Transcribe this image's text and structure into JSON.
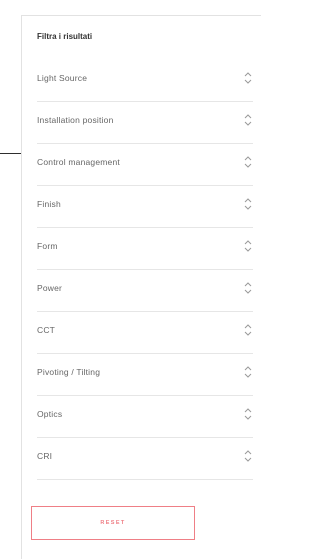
{
  "filters": {
    "title": "Filtra i risultati",
    "items": [
      {
        "label": "Light Source"
      },
      {
        "label": "Installation position"
      },
      {
        "label": "Control management"
      },
      {
        "label": "Finish"
      },
      {
        "label": "Form"
      },
      {
        "label": "Power"
      },
      {
        "label": "CCT"
      },
      {
        "label": "Pivoting / Tilting"
      },
      {
        "label": "Optics"
      },
      {
        "label": "CRI"
      }
    ],
    "reset_label": "RESET",
    "icon": "up-down-chevron-icon",
    "accent_color": "#ef7f86"
  }
}
